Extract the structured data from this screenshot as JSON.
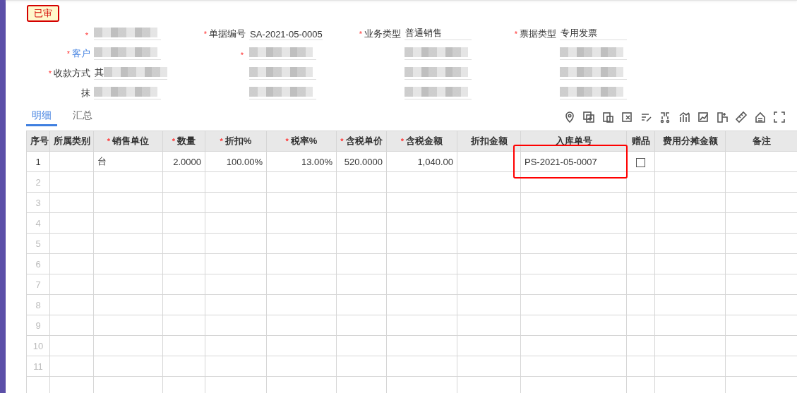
{
  "status_badge": "已审",
  "form_fields": [
    {
      "required_mark": "*",
      "link": false,
      "redacted": true
    },
    {
      "required_mark": "*",
      "label": "单据编号",
      "value": "SA-2021-05-0005",
      "link": false,
      "redacted": false
    },
    {
      "required_mark": "*",
      "label": "业务类型",
      "value": "普通销售",
      "link": false,
      "redacted": false
    },
    {
      "required_mark": "*",
      "label": "票据类型",
      "value": "专用发票",
      "link": false,
      "redacted": false
    },
    {
      "required_mark": "*",
      "label": "客户",
      "link": true,
      "redacted": true
    },
    {
      "required_mark": "*",
      "link": true,
      "redacted": true
    },
    {
      "link": false,
      "redacted": true
    },
    {
      "link": false,
      "redacted": true
    },
    {
      "required_mark": "*",
      "label": "收款方式",
      "value": "其",
      "link": false,
      "redacted": true
    },
    {
      "link": false,
      "redacted": true
    },
    {
      "link": false,
      "redacted": true
    },
    {
      "link": false,
      "redacted": true
    },
    {
      "label": "抹",
      "link": false,
      "redacted": true
    },
    {
      "link": false,
      "redacted": true
    },
    {
      "link": false,
      "redacted": true
    },
    {
      "link": false,
      "redacted": true
    }
  ],
  "tabs": [
    {
      "label": "明细",
      "selected": true
    },
    {
      "label": "汇总",
      "selected": false
    }
  ],
  "toolbar": [
    {
      "kind": "pin"
    },
    {
      "kind": "add"
    },
    {
      "kind": "paste"
    },
    {
      "kind": "delete"
    },
    {
      "kind": "edit"
    },
    {
      "kind": "split"
    },
    {
      "kind": "chart"
    },
    {
      "kind": "trend"
    },
    {
      "kind": "layout"
    },
    {
      "kind": "ruler"
    },
    {
      "kind": "home"
    },
    {
      "kind": "fullscreen"
    }
  ],
  "table": {
    "columns": [
      {
        "label": "序号"
      },
      {
        "label": "所属类别"
      },
      {
        "required_mark": "*",
        "label": "销售单位"
      },
      {
        "required_mark": "*",
        "label": "数量"
      },
      {
        "required_mark": "*",
        "label": "折扣%"
      },
      {
        "required_mark": "*",
        "label": "税率%"
      },
      {
        "required_mark": "*",
        "label": "含税单价"
      },
      {
        "required_mark": "*",
        "label": "含税金额"
      },
      {
        "label": "折扣金额"
      },
      {
        "label": "入库单号"
      },
      {
        "label": "赠品"
      },
      {
        "label": "费用分摊金额"
      },
      {
        "label": "备注"
      }
    ],
    "rows": [
      {
        "disabled": false,
        "cells": [
          "1",
          "",
          "台",
          "2.0000",
          "100.00%",
          "13.00%",
          "520.0000",
          "1,040.00",
          "",
          "PS-2021-05-0007"
        ],
        "gift_checked": false,
        "highlighted": true
      },
      {
        "disabled": true,
        "cells": [
          "2"
        ],
        "highlighted": false
      },
      {
        "disabled": true,
        "cells": [
          "3"
        ],
        "highlighted": false
      },
      {
        "disabled": true,
        "cells": [
          "4"
        ],
        "highlighted": false
      },
      {
        "disabled": true,
        "cells": [
          "5"
        ],
        "highlighted": false
      },
      {
        "disabled": true,
        "cells": [
          "6"
        ],
        "highlighted": false
      },
      {
        "disabled": true,
        "cells": [
          "7"
        ],
        "highlighted": false
      },
      {
        "disabled": true,
        "cells": [
          "8"
        ],
        "highlighted": false
      },
      {
        "disabled": true,
        "cells": [
          "9"
        ],
        "highlighted": false
      },
      {
        "disabled": true,
        "cells": [
          "10"
        ],
        "highlighted": false
      },
      {
        "disabled": true,
        "cells": [
          "11"
        ],
        "highlighted": false
      }
    ]
  }
}
